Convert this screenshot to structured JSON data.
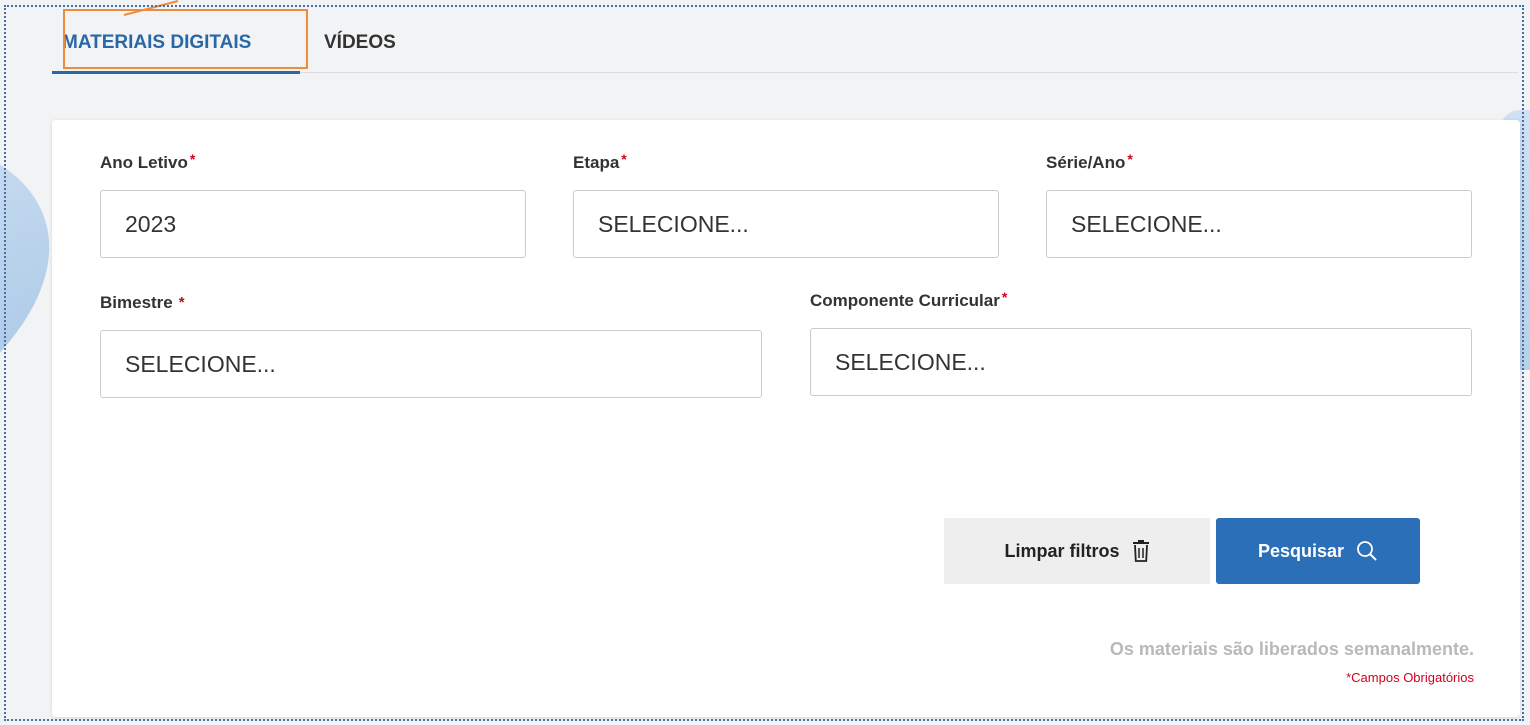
{
  "tabs": [
    {
      "label": "MATERIAIS DIGITAIS",
      "active": true
    },
    {
      "label": "VÍDEOS",
      "active": false
    }
  ],
  "form": {
    "required_mark": "*",
    "ano_letivo": {
      "label": "Ano Letivo",
      "value": "2023"
    },
    "etapa": {
      "label": "Etapa",
      "value": "SELECIONE..."
    },
    "serie_ano": {
      "label": "Série/Ano",
      "value": "SELECIONE..."
    },
    "bimestre": {
      "label": "Bimestre",
      "value": "SELECIONE..."
    },
    "componente": {
      "label": "Componente Curricular",
      "value": "SELECIONE..."
    }
  },
  "buttons": {
    "clear": {
      "label": "Limpar filtros",
      "icon": "trash-icon"
    },
    "search": {
      "label": "Pesquisar",
      "icon": "search-icon"
    }
  },
  "notes": {
    "weekly": "Os materiais são liberados semanalmente.",
    "required": "*Campos Obrigatórios"
  },
  "colors": {
    "accent": "#2a67a6",
    "button_primary": "#2a6fb8",
    "required": "#d0021b",
    "highlight": "#ee8c3c"
  }
}
